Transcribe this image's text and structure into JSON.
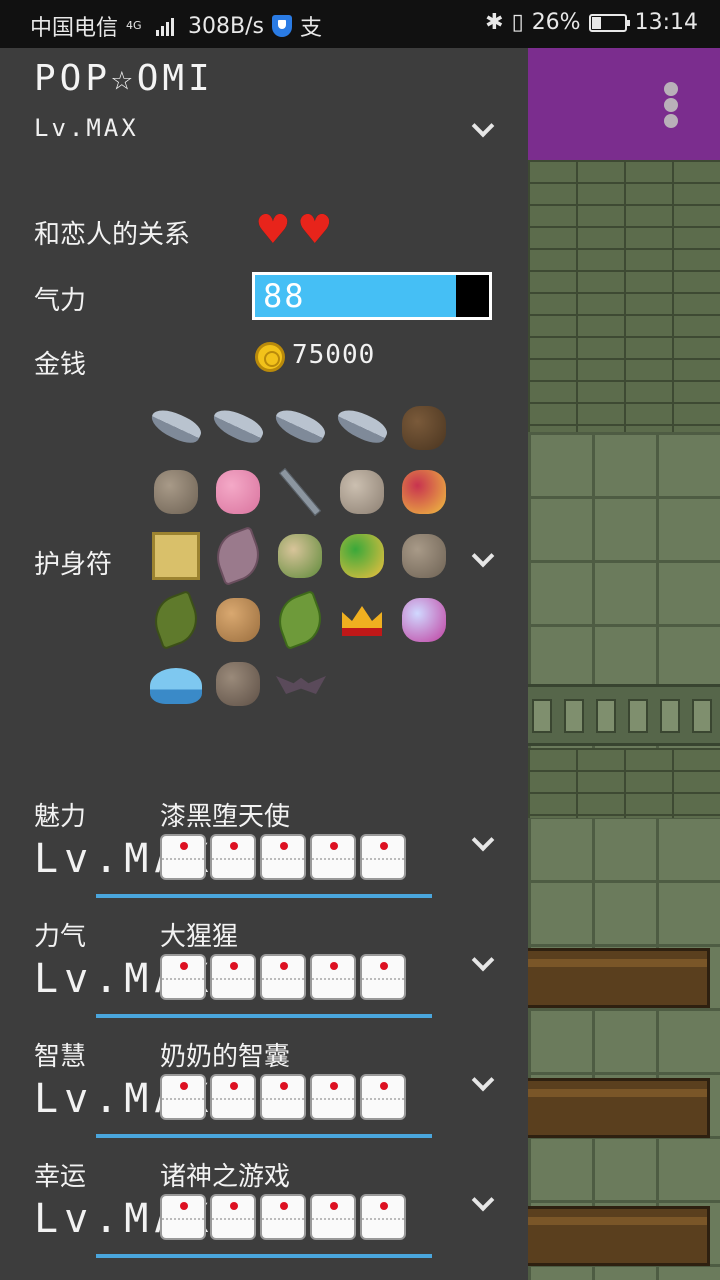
{
  "status_bar": {
    "carrier": "中国电信",
    "network": "4G",
    "speed": "308B/s",
    "app_badge": "支",
    "battery": "26%",
    "time": "13:14"
  },
  "header": {
    "name": "POP☆OMI",
    "level": "Lv.MAX"
  },
  "relationship": {
    "label": "和恋人的关系",
    "hearts": 2
  },
  "energy": {
    "label": "气力",
    "value": "88",
    "fill_fraction": 0.86
  },
  "money": {
    "label": "金钱",
    "value": "75000"
  },
  "amulets": {
    "label": "护身符",
    "items": [
      "fish-icon",
      "fish-icon",
      "fish-icon",
      "fish-icon",
      "branch-icon",
      "clam-icon",
      "bear-doll-icon",
      "sword-icon",
      "fossil-icon",
      "jewel-box-icon",
      "golden-tablet-icon",
      "leaf-icon",
      "radish-icon",
      "winged-gem-icon",
      "clam-icon",
      "herb-icon",
      "figurine-icon",
      "green-leaf-icon",
      "crown-icon",
      "tiara-icon",
      "whale-icon",
      "clay-doll-icon",
      "bat-icon"
    ]
  },
  "stats": [
    {
      "category": "魅力",
      "title": "漆黑堕天使",
      "level": "Lv.MAX"
    },
    {
      "category": "力气",
      "title": "大猩猩",
      "level": "Lv.MAX"
    },
    {
      "category": "智慧",
      "title": "奶奶的智囊",
      "level": "Lv.MAX"
    },
    {
      "category": "幸运",
      "title": "诸神之游戏",
      "level": "Lv.MAX"
    }
  ],
  "colors": {
    "panel": "#3d3d3d",
    "energy_bar": "#45bff5",
    "underline": "#4aa6dd",
    "game_header": "#7b2d8e"
  }
}
